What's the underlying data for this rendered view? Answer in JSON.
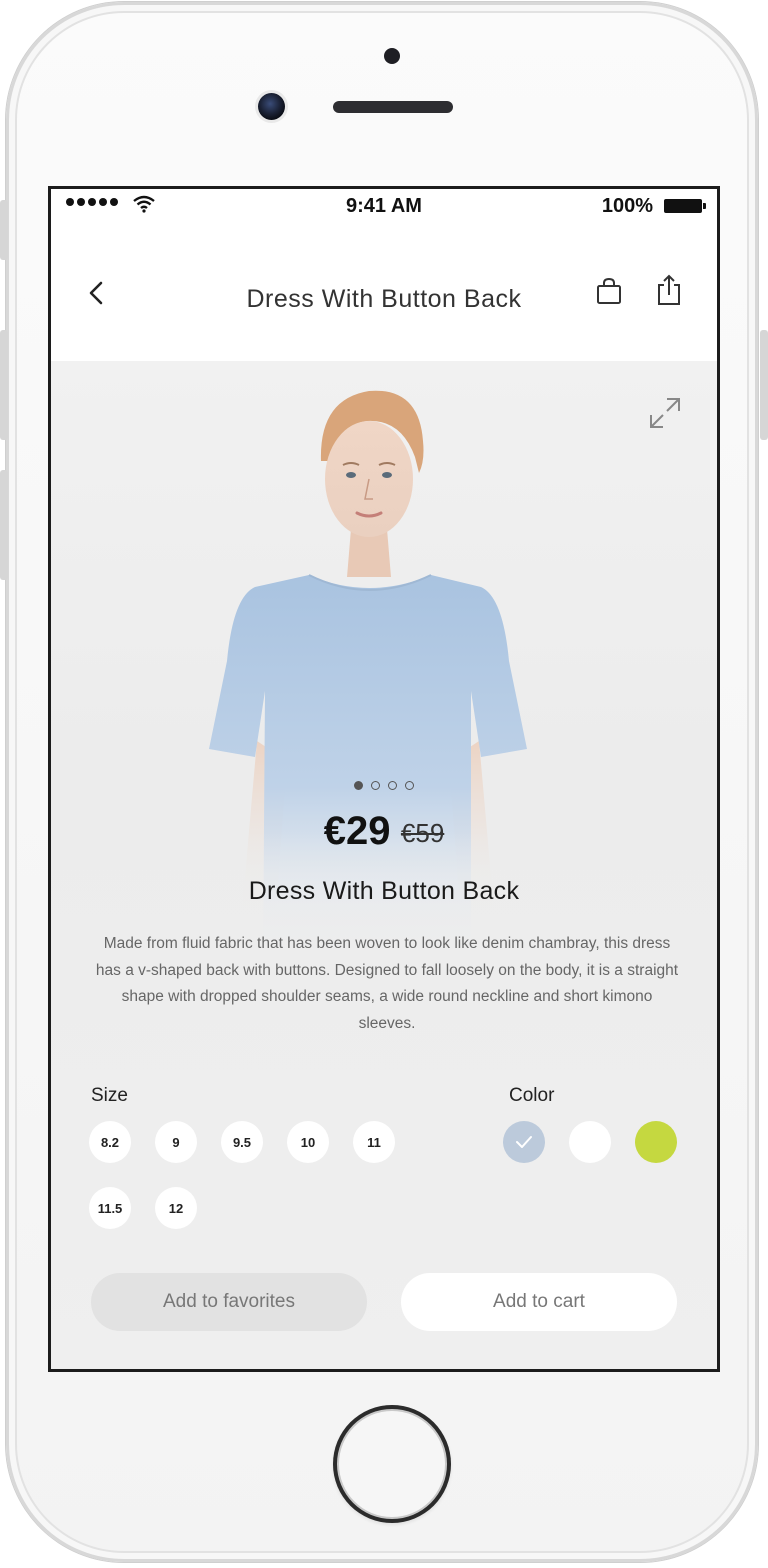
{
  "status_bar": {
    "time": "9:41 AM",
    "battery": "100%"
  },
  "nav": {
    "title": "Dress With Button Back",
    "back_icon": "chevron-left-icon",
    "bag_icon": "shopping-bag-icon",
    "share_icon": "share-icon"
  },
  "product": {
    "image_pages": 4,
    "active_page": 1,
    "price": "€29",
    "old_price": "€59",
    "title": "Dress With Button Back",
    "description": "Made from fluid fabric that has been woven to look like denim chambray, this dress has a v-shaped back with buttons. Designed to fall loosely on the body, it is a straight shape with dropped shoulder seams, a wide round neckline and short kimono sleeves."
  },
  "size": {
    "label": "Size",
    "options": [
      "8.2",
      "9",
      "9.5",
      "10",
      "11",
      "11.5",
      "12"
    ]
  },
  "color": {
    "label": "Color",
    "options": [
      {
        "name": "light-blue",
        "hex": "#bccadb",
        "selected": true
      },
      {
        "name": "white",
        "hex": "#ffffff",
        "selected": false
      },
      {
        "name": "lime",
        "hex": "#c5d840",
        "selected": false
      }
    ]
  },
  "actions": {
    "favorites": "Add to favorites",
    "cart": "Add to cart"
  }
}
